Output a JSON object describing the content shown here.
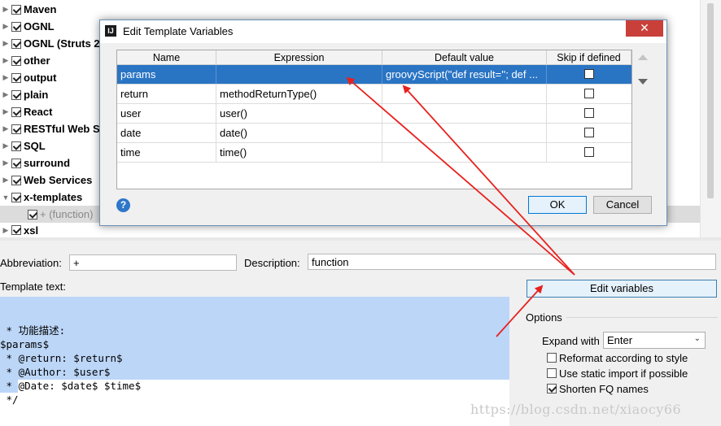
{
  "tree": {
    "items": [
      {
        "label": "Maven"
      },
      {
        "label": "OGNL"
      },
      {
        "label": "OGNL (Struts 2"
      },
      {
        "label": "other"
      },
      {
        "label": "output"
      },
      {
        "label": "plain"
      },
      {
        "label": "React"
      },
      {
        "label": "RESTful Web Se"
      },
      {
        "label": "SQL"
      },
      {
        "label": "surround"
      },
      {
        "label": "Web Services"
      },
      {
        "label": "x-templates"
      }
    ],
    "child": {
      "label": "+ (function)"
    },
    "last": {
      "label": "xsl"
    }
  },
  "form": {
    "abbreviation_label": "Abbreviation:",
    "abbreviation_value": "+",
    "description_label": "Description:",
    "description_value": "function",
    "template_text_label": "Template text:",
    "template_lines": [
      " * 功能描述:",
      "$params$",
      " * @return: $return$",
      " * @Author: $user$",
      " * @Date: $date$ $time$",
      " */"
    ],
    "edit_variables_label": "Edit variables",
    "options_label": "Options",
    "expand_with_label": "Expand with",
    "expand_with_value": "Enter",
    "reformat_label": "Reformat according to style",
    "static_import_label": "Use static import if possible",
    "shorten_fq_label": "Shorten FQ names"
  },
  "dialog": {
    "title": "Edit Template Variables",
    "close_glyph": "✕",
    "columns": [
      "Name",
      "Expression",
      "Default value",
      "Skip if defined"
    ],
    "rows": [
      {
        "name": "params",
        "expression": "",
        "default": "groovyScript(\"def result=''; def ...",
        "skip": false
      },
      {
        "name": "return",
        "expression": "methodReturnType()",
        "default": "",
        "skip": false
      },
      {
        "name": "user",
        "expression": "user()",
        "default": "",
        "skip": false
      },
      {
        "name": "date",
        "expression": "date()",
        "default": "",
        "skip": false
      },
      {
        "name": "time",
        "expression": "time()",
        "default": "",
        "skip": false
      }
    ],
    "help_glyph": "?",
    "ok_label": "OK",
    "cancel_label": "Cancel"
  },
  "watermark": "https://blog.csdn.net/xiaocy66",
  "colors": {
    "selection": "#2a74c4",
    "text_selection": "#bcd6f8",
    "arrow": "#e8211e"
  }
}
